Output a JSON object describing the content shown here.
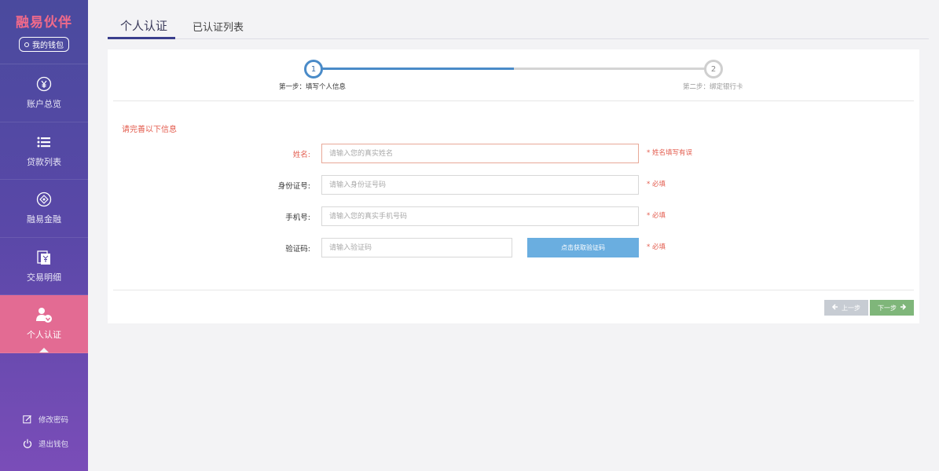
{
  "brand": {
    "title": "融易伙伴",
    "wallet_label": "我的钱包"
  },
  "sidebar": {
    "items": [
      {
        "label": "账户总览",
        "icon": "yen-circle-icon"
      },
      {
        "label": "贷款列表",
        "icon": "list-icon"
      },
      {
        "label": "融易金融",
        "icon": "finance-icon"
      },
      {
        "label": "交易明细",
        "icon": "transaction-icon"
      },
      {
        "label": "个人认证",
        "icon": "user-verify-icon",
        "active": true
      }
    ],
    "bottom_links": [
      {
        "label": "修改密码",
        "icon": "edit-icon"
      },
      {
        "label": "退出钱包",
        "icon": "power-icon"
      }
    ]
  },
  "tabs": [
    {
      "label": "个人认证",
      "active": true
    },
    {
      "label": "已认证列表",
      "active": false
    }
  ],
  "steps": [
    {
      "number": "1",
      "label": "第一步：填写个人信息",
      "active": true
    },
    {
      "number": "2",
      "label": "第二步：绑定银行卡",
      "active": false
    }
  ],
  "progress": 0.5,
  "section_title": "请完善以下信息",
  "form": {
    "name": {
      "label": "姓名:",
      "placeholder": "请输入您的真实姓名",
      "hint": "* 姓名填写有误"
    },
    "id_number": {
      "label": "身份证号:",
      "placeholder": "请输入身份证号码",
      "hint": "* 必填"
    },
    "phone": {
      "label": "手机号:",
      "placeholder": "请输入您的真实手机号码",
      "hint": "* 必填"
    },
    "code": {
      "label": "验证码:",
      "placeholder": "请输入验证码",
      "button": "点击获取验证码",
      "hint": "* 必填"
    }
  },
  "buttons": {
    "prev": "上一步",
    "next": "下一步"
  },
  "colors": {
    "accent": "#4a8bc8",
    "error": "#e35c4e",
    "active_nav": "#e36b93",
    "next": "#7fb67a"
  }
}
